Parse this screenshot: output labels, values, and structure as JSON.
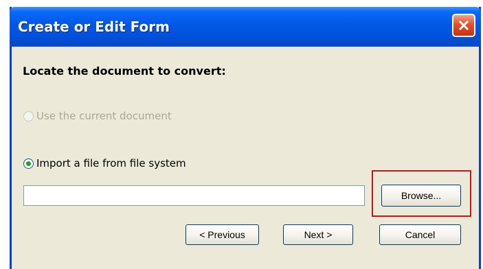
{
  "dialog": {
    "title": "Create or Edit Form",
    "heading": "Locate the document to convert:",
    "options": [
      {
        "label": "Use the current document",
        "selected": false,
        "enabled": false
      },
      {
        "label": "Import a file from file system",
        "selected": true,
        "enabled": true
      }
    ],
    "file_path": {
      "value": "",
      "placeholder": ""
    },
    "browse_label": "Browse...",
    "previous_label": "< Previous",
    "next_label": "Next >",
    "cancel_label": "Cancel"
  },
  "icons": {
    "close": "close-icon"
  },
  "colors": {
    "titlebar": "#0257e6",
    "close_button": "#e2512e",
    "highlight": "#c3161c",
    "selected_radio": "#21a121",
    "window_bg": "#ece9d8"
  }
}
